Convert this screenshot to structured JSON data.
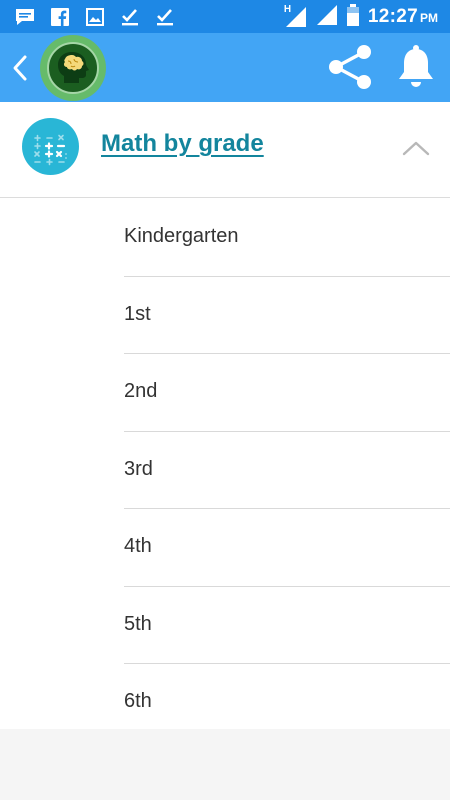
{
  "status_bar": {
    "icons_left": [
      "message-icon",
      "facebook-icon",
      "image-icon",
      "checkmark-icon",
      "checkmark-icon"
    ],
    "network_label": "H",
    "time": "12:27",
    "ampm": "PM"
  },
  "app_bar": {
    "back_icon": "chevron-left-icon",
    "logo_icon": "brain-head-icon",
    "share_icon": "share-icon",
    "bell_icon": "bell-icon"
  },
  "section": {
    "title": "Math by grade",
    "topic_icon": "math-symbols-icon",
    "collapse_icon": "chevron-up-icon",
    "expanded": true
  },
  "grades": [
    {
      "label": "Kindergarten"
    },
    {
      "label": "1st"
    },
    {
      "label": "2nd"
    },
    {
      "label": "3rd"
    },
    {
      "label": "4th"
    },
    {
      "label": "5th"
    },
    {
      "label": "6th"
    }
  ],
  "colors": {
    "status_bar": "#1e88e5",
    "app_bar": "#42a5f5",
    "title": "#13859d",
    "topic_icon_bg": "#29b6d6",
    "logo_green": "#66bb6a"
  }
}
